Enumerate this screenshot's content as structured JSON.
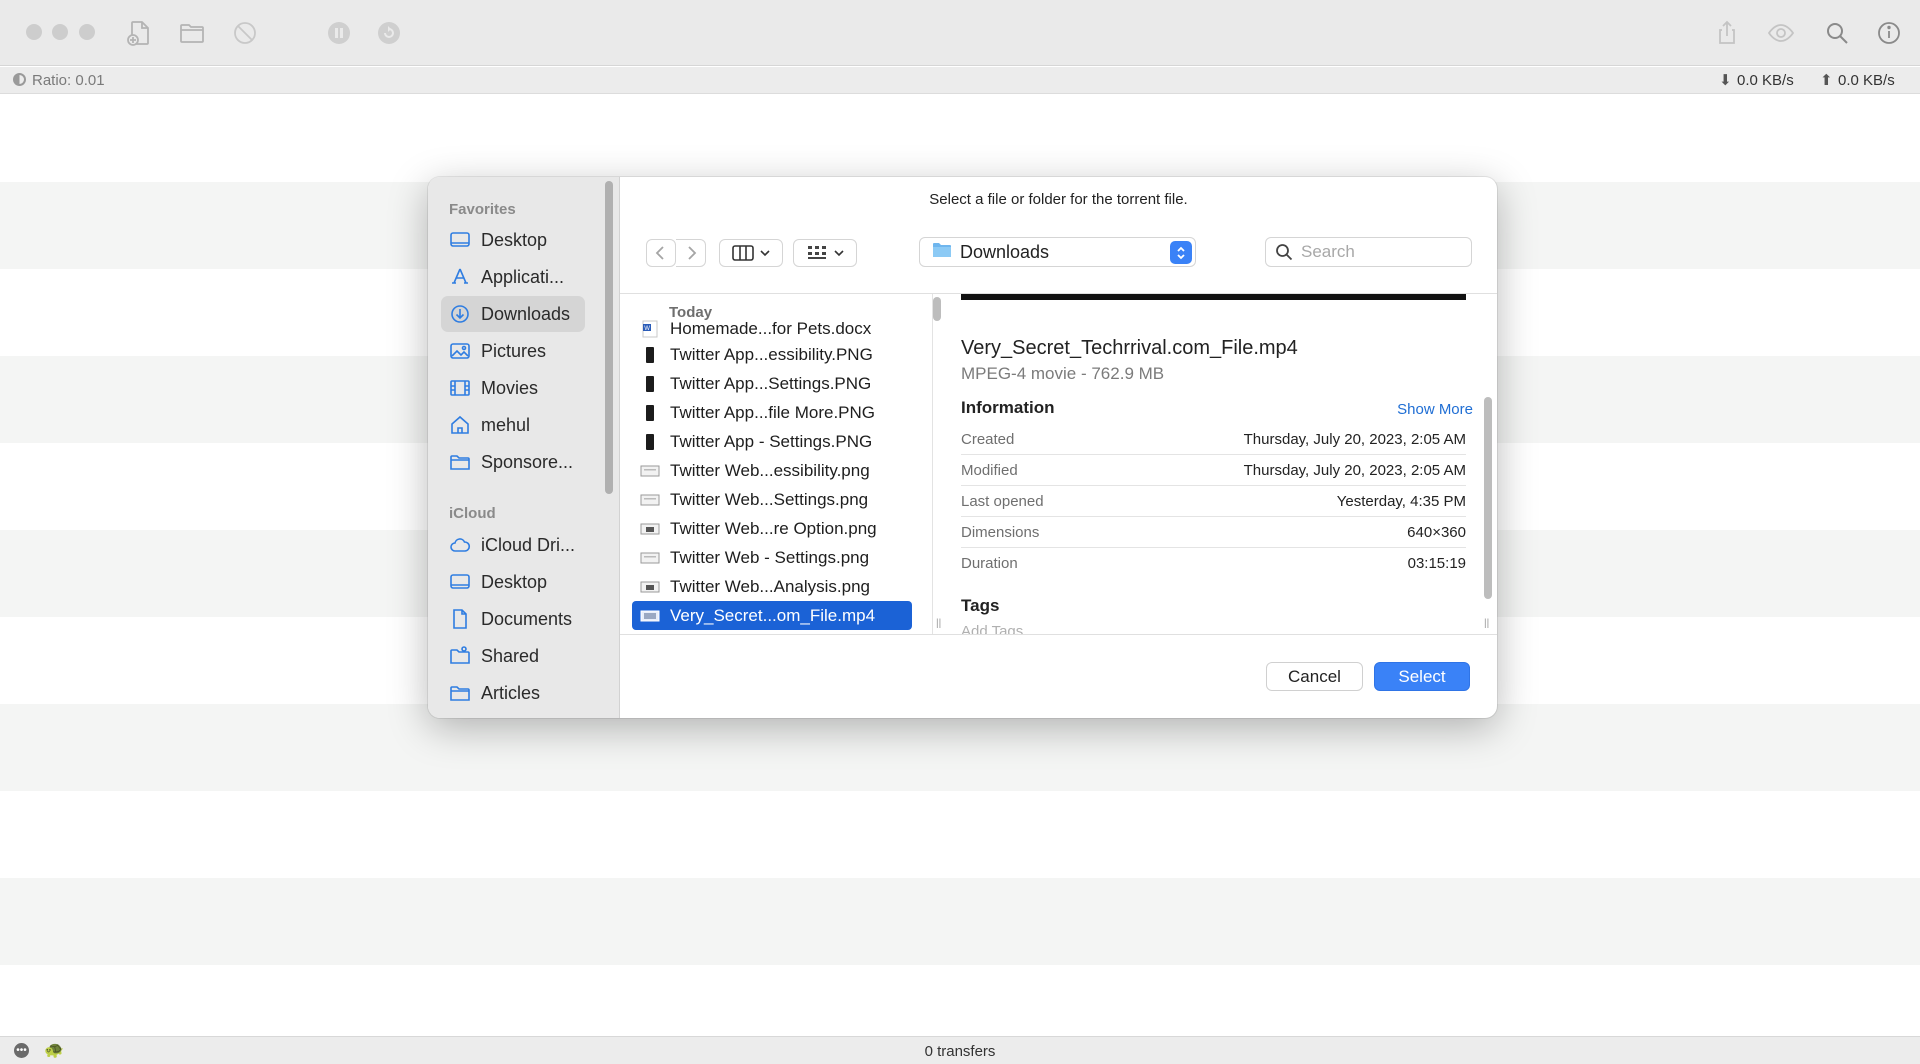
{
  "titlebar": {
    "icons": [
      "close-light",
      "minimize-light",
      "zoom-light",
      "add-torrent-icon",
      "open-folder-icon",
      "remove-icon",
      "pause-icon",
      "resume-icon",
      "share-icon",
      "quicklook-eye-icon",
      "search-icon",
      "info-icon"
    ]
  },
  "status": {
    "ratio": "Ratio: 0.01",
    "download_speed": "0.0 KB/s",
    "upload_speed": "0.0 KB/s"
  },
  "bottom": {
    "transfers": "0 transfers"
  },
  "dialog": {
    "prompt": "Select a file or folder for the torrent file.",
    "location": "Downloads",
    "search_placeholder": "Search",
    "sidebar": {
      "favorites_header": "Favorites",
      "favorites": [
        {
          "label": "Desktop",
          "icon": "desktop-icon"
        },
        {
          "label": "Applicati...",
          "icon": "applications-icon"
        },
        {
          "label": "Downloads",
          "icon": "downloads-icon",
          "selected": true
        },
        {
          "label": "Pictures",
          "icon": "pictures-icon"
        },
        {
          "label": "Movies",
          "icon": "movies-icon"
        },
        {
          "label": "mehul",
          "icon": "home-icon"
        },
        {
          "label": "Sponsore...",
          "icon": "folder-icon"
        }
      ],
      "icloud_header": "iCloud",
      "icloud": [
        {
          "label": "iCloud Dri...",
          "icon": "icloud-icon"
        },
        {
          "label": "Desktop",
          "icon": "desktop-icon"
        },
        {
          "label": "Documents",
          "icon": "document-icon"
        },
        {
          "label": "Shared",
          "icon": "shared-folder-icon"
        },
        {
          "label": "Articles",
          "icon": "folder-icon"
        }
      ]
    },
    "files": {
      "group_header": "Today",
      "items": [
        {
          "name": "Homemade...for Pets.docx",
          "icon": "word-doc-icon"
        },
        {
          "name": "Twitter App...essibility.PNG",
          "icon": "phone-image-icon"
        },
        {
          "name": "Twitter App...Settings.PNG",
          "icon": "phone-image-icon"
        },
        {
          "name": "Twitter App...file More.PNG",
          "icon": "phone-image-icon"
        },
        {
          "name": "Twitter App - Settings.PNG",
          "icon": "phone-image-icon"
        },
        {
          "name": "Twitter Web...essibility.png",
          "icon": "web-image-icon"
        },
        {
          "name": "Twitter Web...Settings.png",
          "icon": "web-image-icon"
        },
        {
          "name": "Twitter Web...re Option.png",
          "icon": "web-image-icon"
        },
        {
          "name": "Twitter Web - Settings.png",
          "icon": "web-image-icon"
        },
        {
          "name": "Twitter Web...Analysis.png",
          "icon": "web-image-icon"
        },
        {
          "name": "Very_Secret...om_File.mp4",
          "icon": "video-icon",
          "selected": true
        }
      ]
    },
    "preview": {
      "filename": "Very_Secret_Techrrival.com_File.mp4",
      "kind": "MPEG-4 movie - 762.9 MB",
      "info_header": "Information",
      "show_more": "Show More",
      "rows": [
        {
          "key": "Created",
          "value": "Thursday, July 20, 2023, 2:05 AM"
        },
        {
          "key": "Modified",
          "value": "Thursday, July 20, 2023, 2:05 AM"
        },
        {
          "key": "Last opened",
          "value": "Yesterday, 4:35 PM"
        },
        {
          "key": "Dimensions",
          "value": "640×360"
        },
        {
          "key": "Duration",
          "value": "03:15:19"
        }
      ],
      "tags_header": "Tags",
      "add_tags": "Add Tags"
    },
    "buttons": {
      "cancel": "Cancel",
      "select": "Select"
    }
  },
  "colors": {
    "accent": "#3a82f7",
    "selection": "#1b62d6",
    "link": "#1f6ed4"
  }
}
